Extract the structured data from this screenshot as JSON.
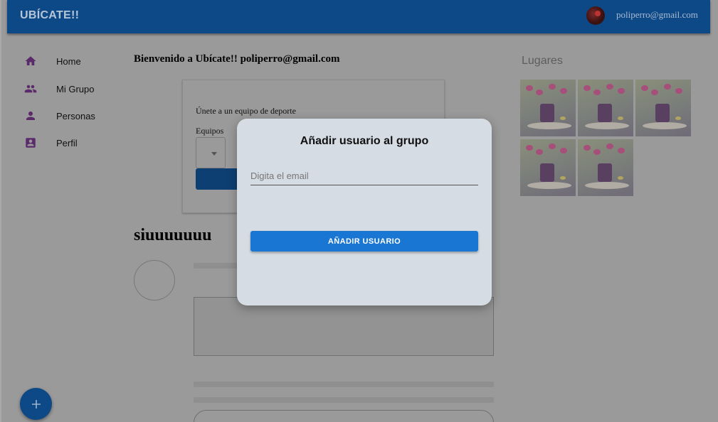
{
  "header": {
    "app_title": "UBÍCATE!!",
    "user_email": "poliperro@gmail.com"
  },
  "nav": {
    "items": [
      {
        "label": "Home",
        "icon": "home-icon"
      },
      {
        "label": "Mi Grupo",
        "icon": "group-icon"
      },
      {
        "label": "Personas",
        "icon": "person-icon"
      },
      {
        "label": "Perfil",
        "icon": "profile-icon"
      }
    ]
  },
  "main": {
    "welcome": "Bienvenido a Ubícate!! poliperro@gmail.com",
    "join_card": {
      "text": "Únete a un equipo de deporte",
      "select_label": "Equipos"
    },
    "group_name": "siuuuuuuu"
  },
  "places": {
    "title": "Lugares"
  },
  "modal": {
    "title": "Añadir usuario al grupo",
    "email_placeholder": "Digita el email",
    "email_value": "",
    "submit_label": "AÑADIR USUARIO"
  },
  "fab": {
    "icon": "plus-icon",
    "symbol": "+"
  },
  "colors": {
    "appbar": "#0d4987",
    "accent_button": "#1976d2",
    "nav_icon": "#7b1fa2"
  }
}
